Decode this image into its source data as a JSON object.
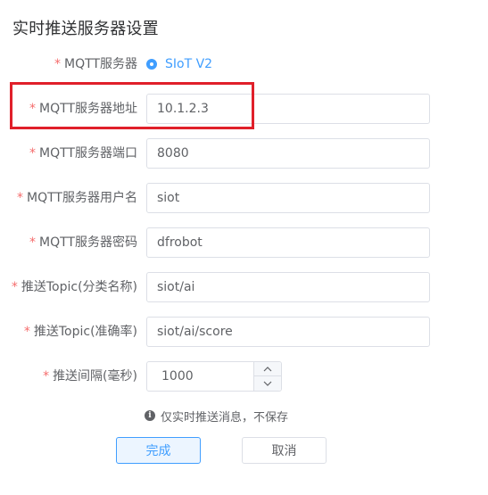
{
  "title": "实时推送服务器设置",
  "form": {
    "required_mark": "*",
    "server": {
      "label": "MQTT服务器",
      "option": "SIoT V2"
    },
    "address": {
      "label": "MQTT服务器地址",
      "value": "10.1.2.3"
    },
    "port": {
      "label": "MQTT服务器端口",
      "value": "8080"
    },
    "username": {
      "label": "MQTT服务器用户名",
      "value": "siot"
    },
    "password": {
      "label": "MQTT服务器密码",
      "value": "dfrobot"
    },
    "topic_category": {
      "label": "推送Topic(分类名称)",
      "value": "siot/ai"
    },
    "topic_accuracy": {
      "label": "推送Topic(准确率)",
      "value": "siot/ai/score"
    },
    "interval": {
      "label": "推送间隔(毫秒)",
      "value": "1000"
    }
  },
  "note": {
    "icon": "info-icon",
    "text": "仅实时推送消息，不保存"
  },
  "buttons": {
    "confirm": "完成",
    "cancel": "取消"
  },
  "colors": {
    "accent": "#409eff",
    "required": "#f56c6c",
    "highlight": "#e0202a"
  }
}
